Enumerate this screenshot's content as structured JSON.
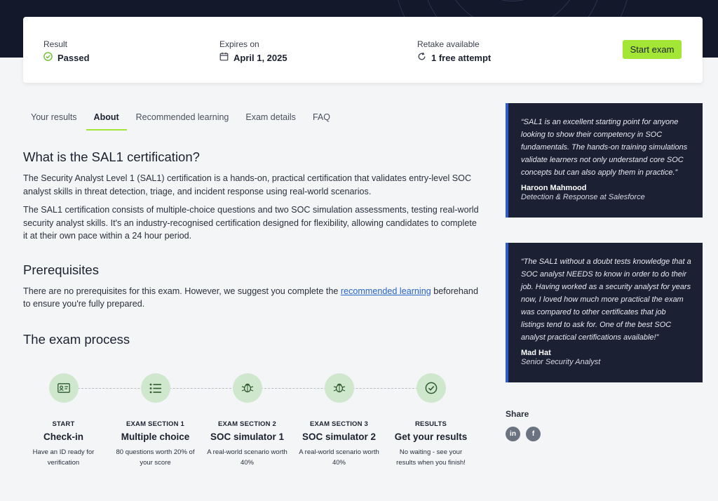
{
  "summary": {
    "result_label": "Result",
    "result_value": "Passed",
    "expires_label": "Expires on",
    "expires_value": "April 1, 2025",
    "retake_label": "Retake available",
    "retake_value": "1 free attempt",
    "start_button": "Start exam",
    "accent_color": "#a3e635"
  },
  "tabs": [
    {
      "label": "Your results"
    },
    {
      "label": "About",
      "active": true
    },
    {
      "label": "Recommended learning"
    },
    {
      "label": "Exam details"
    },
    {
      "label": "FAQ"
    }
  ],
  "about": {
    "heading": "What is the SAL1 certification?",
    "para1": "The Security Analyst Level 1 (SAL1) certification is a hands-on, practical certification that validates entry-level SOC analyst skills in threat detection, triage, and incident response using real-world scenarios.",
    "para2": "The SAL1 certification consists of multiple-choice questions and two SOC simulation assessments, testing real-world security analyst skills. It's an industry-recognised certification designed for flexibility, allowing candidates to complete it at their own pace within a 24 hour period."
  },
  "prereq": {
    "heading": "Prerequisites",
    "text_before": "There are no prerequisites for this exam. However, we suggest you complete the ",
    "link_text": "recommended learning",
    "text_after": " beforehand to ensure you're fully prepared."
  },
  "process": {
    "heading": "The exam process",
    "steps": [
      {
        "kicker": "START",
        "title": "Check-in",
        "desc": "Have an ID ready for verification",
        "icon": "id-card-icon"
      },
      {
        "kicker": "EXAM SECTION 1",
        "title": "Multiple choice",
        "desc": "80 questions worth 20% of your score",
        "icon": "list-icon"
      },
      {
        "kicker": "EXAM SECTION 2",
        "title": "SOC simulator 1",
        "desc": "A real-world scenario worth 40%",
        "icon": "bug-icon"
      },
      {
        "kicker": "EXAM SECTION 3",
        "title": "SOC simulator 2",
        "desc": "A real-world scenario worth 40%",
        "icon": "bug-icon"
      },
      {
        "kicker": "RESULTS",
        "title": "Get your results",
        "desc": "No waiting - see your results when you finish!",
        "icon": "check-circle-icon"
      }
    ]
  },
  "quotes": [
    {
      "text": "“SAL1 is an excellent starting point for anyone looking to show their competency in SOC fundamentals. The hands-on training simulations validate learners not only understand core SOC concepts but can also apply them in practice.”",
      "author": "Haroon Mahmood",
      "role": "Detection & Response at Salesforce"
    },
    {
      "text": "“The SAL1 without a doubt tests knowledge that a SOC analyst NEEDS to know in order to do their job. Having worked as a security analyst for years now, I loved how much more practical the exam was compared to other certificates that job listings tend to ask for. One of the best SOC analyst practical certifications available!”",
      "author": "Mad Hat",
      "role": "Senior Security Analyst"
    }
  ],
  "share": {
    "label": "Share",
    "icons": [
      {
        "name": "linkedin-icon",
        "glyph": "in"
      },
      {
        "name": "facebook-icon",
        "glyph": "f"
      }
    ]
  }
}
